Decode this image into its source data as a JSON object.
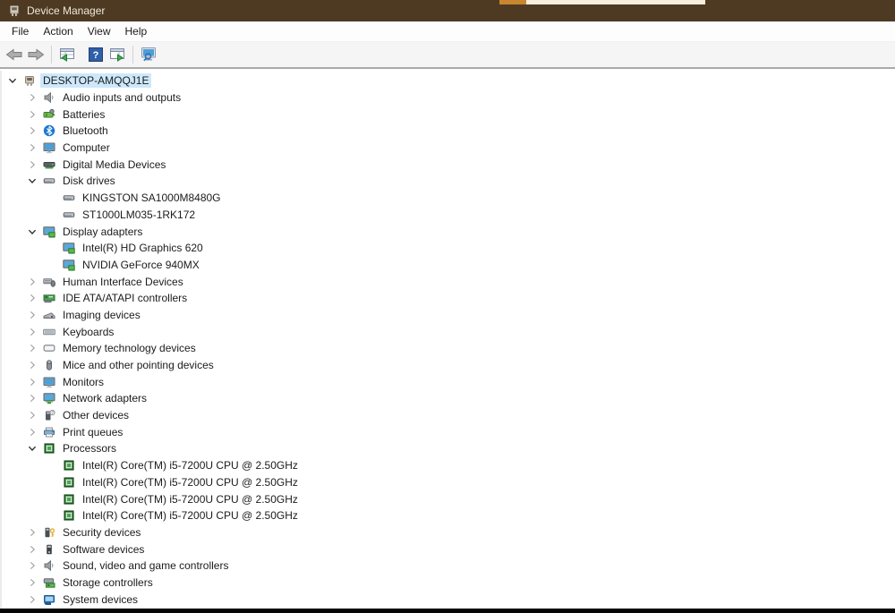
{
  "window": {
    "title": "Device Manager"
  },
  "titlebar_artifact": {
    "orange_color": "#c8862f",
    "cream_color": "#f7eedb"
  },
  "colors": {
    "titlebar_bg": "#4e3a23",
    "selection_bg": "#cde8fc",
    "help_button_blue": "#2f5fa8",
    "toolbar_green": "#3fae49"
  },
  "menu": {
    "items": [
      {
        "label": "File"
      },
      {
        "label": "Action"
      },
      {
        "label": "View"
      },
      {
        "label": "Help"
      }
    ]
  },
  "toolbar": {
    "buttons": [
      {
        "name": "back-button",
        "icon": "back-arrow-icon"
      },
      {
        "name": "forward-button",
        "icon": "forward-arrow-icon"
      },
      {
        "name": "separator"
      },
      {
        "name": "show-console-tree-button",
        "icon": "console-tree-icon"
      },
      {
        "name": "gap"
      },
      {
        "name": "help-button",
        "icon": "help-icon"
      },
      {
        "name": "action-pane-button",
        "icon": "action-pane-icon"
      },
      {
        "name": "separator"
      },
      {
        "name": "scan-hardware-changes-button",
        "icon": "scan-hardware-icon"
      }
    ]
  },
  "tree": {
    "rows": [
      {
        "level": 0,
        "chevron": "expanded",
        "icon": "computer",
        "label": "DESKTOP-AMQQJ1E",
        "selected": true
      },
      {
        "level": 1,
        "chevron": "collapsed",
        "icon": "audio",
        "label": "Audio inputs and outputs"
      },
      {
        "level": 1,
        "chevron": "collapsed",
        "icon": "battery",
        "label": "Batteries"
      },
      {
        "level": 1,
        "chevron": "collapsed",
        "icon": "bluetooth",
        "label": "Bluetooth"
      },
      {
        "level": 1,
        "chevron": "collapsed",
        "icon": "monitor",
        "label": "Computer"
      },
      {
        "level": 1,
        "chevron": "collapsed",
        "icon": "media",
        "label": "Digital Media Devices"
      },
      {
        "level": 1,
        "chevron": "expanded",
        "icon": "disk",
        "label": "Disk drives"
      },
      {
        "level": 2,
        "chevron": "none",
        "icon": "disk",
        "label": "KINGSTON SA1000M8480G"
      },
      {
        "level": 2,
        "chevron": "none",
        "icon": "disk",
        "label": "ST1000LM035-1RK172"
      },
      {
        "level": 1,
        "chevron": "expanded",
        "icon": "display",
        "label": "Display adapters"
      },
      {
        "level": 2,
        "chevron": "none",
        "icon": "display",
        "label": "Intel(R) HD Graphics 620"
      },
      {
        "level": 2,
        "chevron": "none",
        "icon": "display",
        "label": "NVIDIA GeForce 940MX"
      },
      {
        "level": 1,
        "chevron": "collapsed",
        "icon": "hid",
        "label": "Human Interface Devices"
      },
      {
        "level": 1,
        "chevron": "collapsed",
        "icon": "ide",
        "label": "IDE ATA/ATAPI controllers"
      },
      {
        "level": 1,
        "chevron": "collapsed",
        "icon": "imaging",
        "label": "Imaging devices"
      },
      {
        "level": 1,
        "chevron": "collapsed",
        "icon": "keyboard",
        "label": "Keyboards"
      },
      {
        "level": 1,
        "chevron": "collapsed",
        "icon": "memory",
        "label": "Memory technology devices"
      },
      {
        "level": 1,
        "chevron": "collapsed",
        "icon": "mouse",
        "label": "Mice and other pointing devices"
      },
      {
        "level": 1,
        "chevron": "collapsed",
        "icon": "monitor",
        "label": "Monitors"
      },
      {
        "level": 1,
        "chevron": "collapsed",
        "icon": "network",
        "label": "Network adapters"
      },
      {
        "level": 1,
        "chevron": "collapsed",
        "icon": "unknown",
        "label": "Other devices"
      },
      {
        "level": 1,
        "chevron": "collapsed",
        "icon": "printer",
        "label": "Print queues"
      },
      {
        "level": 1,
        "chevron": "expanded",
        "icon": "cpu",
        "label": "Processors"
      },
      {
        "level": 2,
        "chevron": "none",
        "icon": "cpu",
        "label": "Intel(R) Core(TM) i5-7200U CPU @ 2.50GHz"
      },
      {
        "level": 2,
        "chevron": "none",
        "icon": "cpu",
        "label": "Intel(R) Core(TM) i5-7200U CPU @ 2.50GHz"
      },
      {
        "level": 2,
        "chevron": "none",
        "icon": "cpu",
        "label": "Intel(R) Core(TM) i5-7200U CPU @ 2.50GHz"
      },
      {
        "level": 2,
        "chevron": "none",
        "icon": "cpu",
        "label": "Intel(R) Core(TM) i5-7200U CPU @ 2.50GHz"
      },
      {
        "level": 1,
        "chevron": "collapsed",
        "icon": "security",
        "label": "Security devices"
      },
      {
        "level": 1,
        "chevron": "collapsed",
        "icon": "software",
        "label": "Software devices"
      },
      {
        "level": 1,
        "chevron": "collapsed",
        "icon": "sound",
        "label": "Sound, video and game controllers"
      },
      {
        "level": 1,
        "chevron": "collapsed",
        "icon": "storage",
        "label": "Storage controllers"
      },
      {
        "level": 1,
        "chevron": "collapsed",
        "icon": "system",
        "label": "System devices"
      }
    ]
  }
}
